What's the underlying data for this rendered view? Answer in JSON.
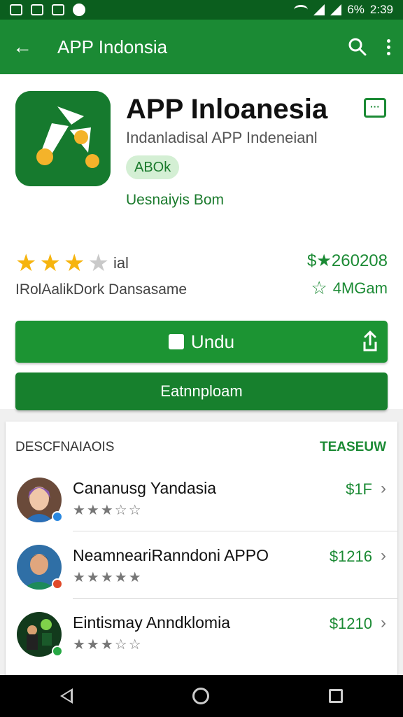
{
  "status_bar": {
    "battery": "6%",
    "time": "2:39"
  },
  "app_bar": {
    "back_icon": "arrow-left-icon",
    "title": "APP Indonsia",
    "search_icon": "search-icon",
    "menu_icon": "more-vert-icon"
  },
  "app": {
    "name": "APP Inloanesia",
    "developer": "Indanladisal APP Indeneianl",
    "chip": "ABOk",
    "sub_link": "Uesnaiyis Bom",
    "rating_suffix": "ial",
    "rating_sub": "IRolAalikDork Dansasame",
    "price_line": "$★260208",
    "downloads": "4MGam"
  },
  "buttons": {
    "install": "Undu",
    "secondary": "Eatnnploam"
  },
  "list": {
    "header": "DESCFNAIAOIS",
    "more": "TEASEUW",
    "items": [
      {
        "title": "Cananusg Yandasia",
        "stars": "★★★☆☆",
        "price": "$1F"
      },
      {
        "title": "NeamneariRanndoni APPO",
        "stars": "★★★★★",
        "price": "$1216"
      },
      {
        "title": "Eintismay Anndklomia",
        "stars": "★★★☆☆",
        "price": "$1210"
      }
    ]
  },
  "colors": {
    "primary": "#1b8a34",
    "dark": "#0b5e1e",
    "star": "#f6b40e"
  }
}
